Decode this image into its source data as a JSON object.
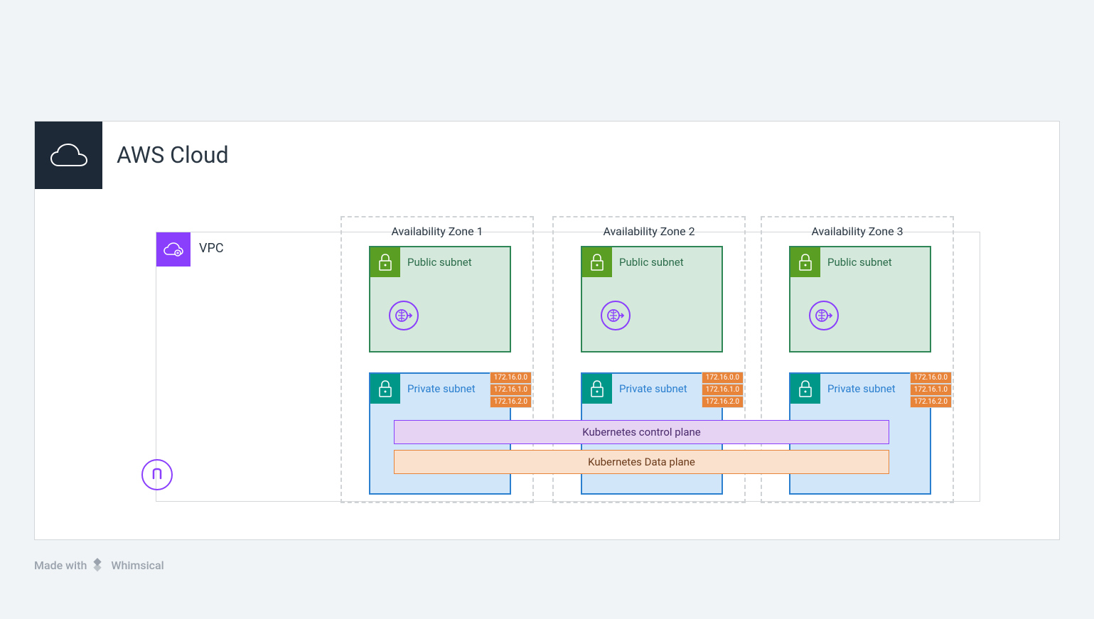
{
  "cloud": {
    "title": "AWS Cloud"
  },
  "vpc": {
    "label": "VPC"
  },
  "availability_zones": [
    {
      "label": "Availability Zone 1"
    },
    {
      "label": "Availability Zone 2"
    },
    {
      "label": "Availability Zone 3"
    }
  ],
  "public_subnet": {
    "label": "Public subnet"
  },
  "private_subnet": {
    "label": "Private subnet",
    "cidrs": [
      "172.16.0.0",
      "172.16.1.0",
      "172.16.2.0"
    ]
  },
  "kubernetes": {
    "control_plane": "Kubernetes control plane",
    "data_plane": "Kubernetes Data plane"
  },
  "footer": {
    "made_with": "Made with",
    "brand": "Whimsical"
  }
}
